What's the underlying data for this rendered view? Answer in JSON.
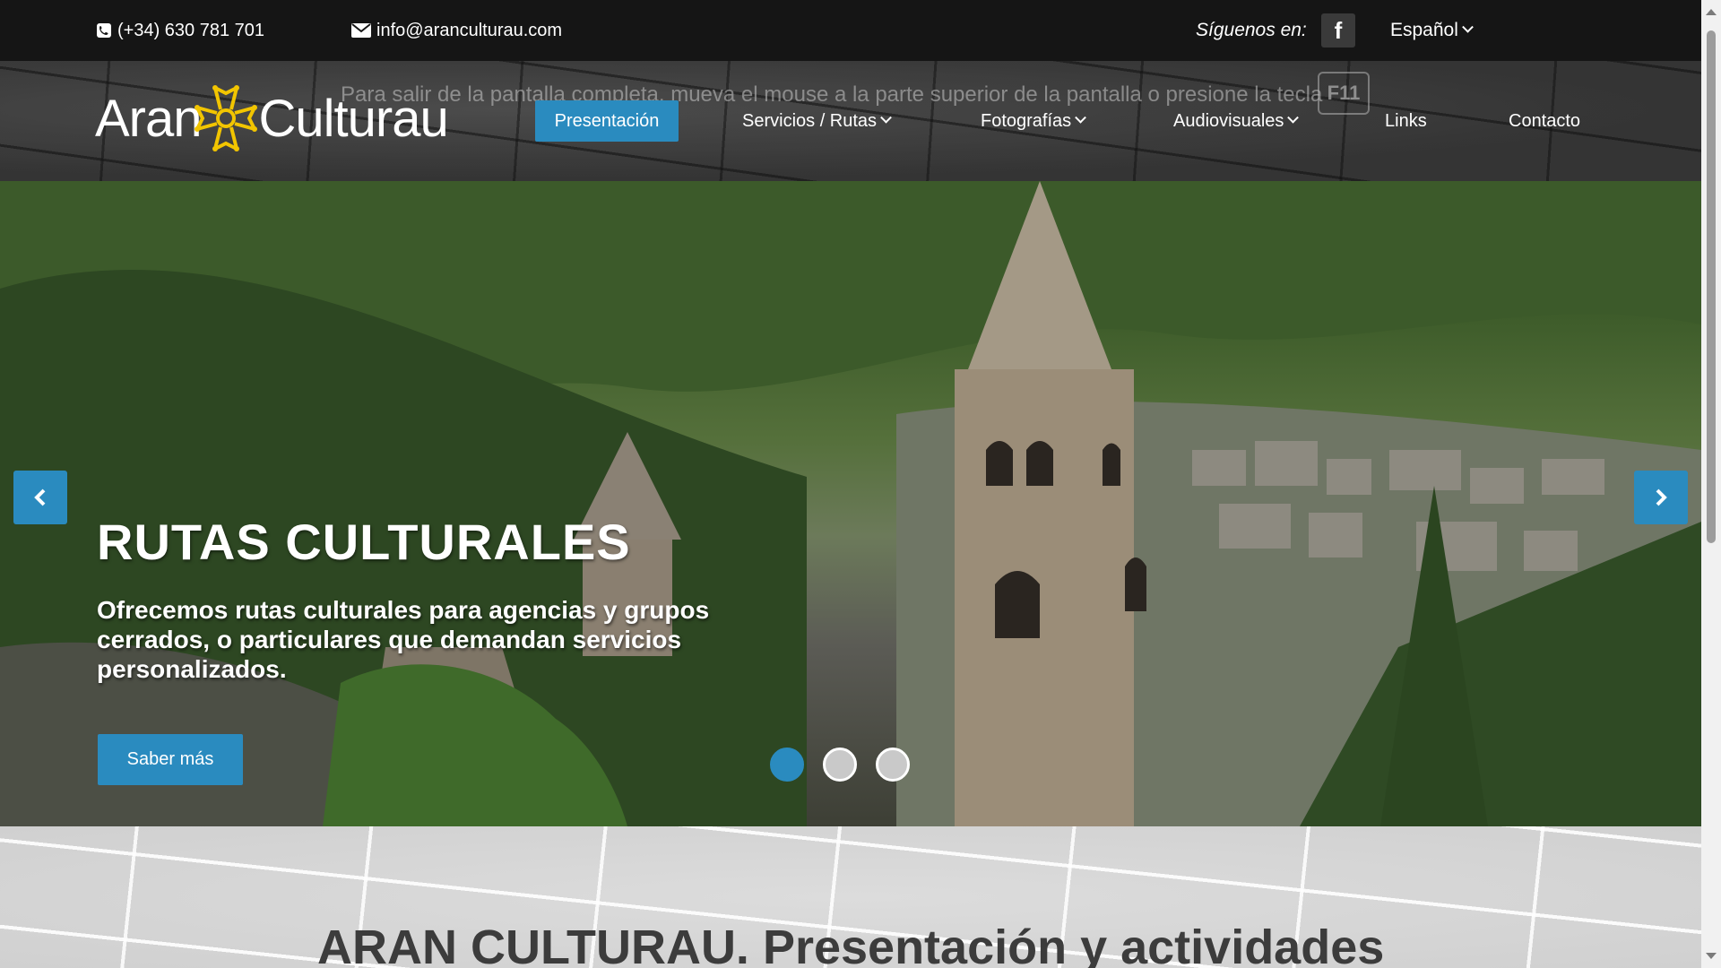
{
  "topbar": {
    "phone": "(+34) 630 781 701",
    "email": "info@aranculturau.com",
    "follow_label": "Síguenos en:",
    "facebook_glyph": "f",
    "language": "Español"
  },
  "header": {
    "logo_left": "Aran",
    "logo_right": "Culturau",
    "fullscreen_hint": "Para salir de la pantalla completa, mueva el mouse a la parte superior de la pantalla o presione la tecla",
    "fullscreen_key": "F11",
    "nav": {
      "presentacion": "Presentación",
      "servicios": "Servicios / Rutas",
      "fotografias": "Fotografías",
      "audiovisuales": "Audiovisuales",
      "links": "Links",
      "contacto": "Contacto"
    }
  },
  "hero": {
    "title": "RUTAS CULTURALES",
    "text": "Ofrecemos rutas culturales para agencias y grupos cerrados, o particulares que demandan servicios personalizados.",
    "button": "Saber más",
    "slides": 3,
    "active_slide": 1
  },
  "section": {
    "title": "ARAN CULTURAU. Presentación y actividades"
  },
  "colors": {
    "accent": "#2a8bbf",
    "topbar": "#151515",
    "logo_cross": "#f2c500"
  },
  "icons": [
    "phone-icon",
    "envelope-icon",
    "facebook-icon",
    "chevron-down-icon",
    "chevron-left-icon",
    "chevron-right-icon"
  ]
}
